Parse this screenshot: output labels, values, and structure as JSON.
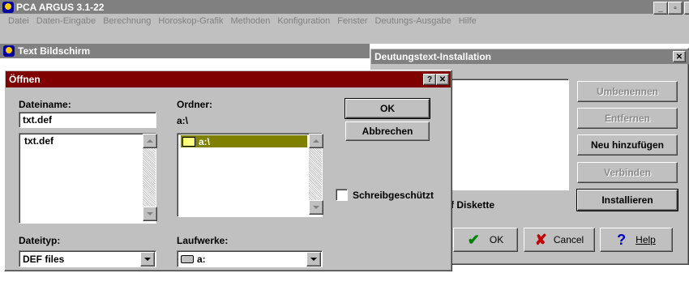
{
  "app": {
    "title": "PCA ARGUS 3.1-22"
  },
  "menu": [
    "Datei",
    "Daten-Eingabe",
    "Berechnung",
    "Horoskop-Grafik",
    "Methoden",
    "Konfiguration",
    "Fenster",
    "Deutungs-Ausgabe",
    "Hilfe"
  ],
  "text_window": {
    "title": "Text Bildschirm"
  },
  "install_window": {
    "title": "Deutungstext-Installation",
    "buttons": {
      "rename": "Umbenennen",
      "remove": "Entfernen",
      "add": "Neu hinzufügen",
      "connect": "Verbinden",
      "install": "Installieren"
    },
    "disk_label": "f Diskette",
    "ok": "OK",
    "cancel": "Cancel",
    "help": "Help"
  },
  "open_dialog": {
    "title": "Öffnen",
    "filename_label": "Dateiname:",
    "filename_value": "txt.def",
    "file_list": [
      "txt.def"
    ],
    "folder_label": "Ordner:",
    "folder_path": "a:\\",
    "folder_list": [
      "a:\\"
    ],
    "ok": "OK",
    "cancel": "Abbrechen",
    "readonly_label": "Schreibgeschützt",
    "filetype_label": "Dateityp:",
    "filetype_value": "DEF files",
    "drives_label": "Laufwerke:",
    "drive_value": "a:"
  }
}
